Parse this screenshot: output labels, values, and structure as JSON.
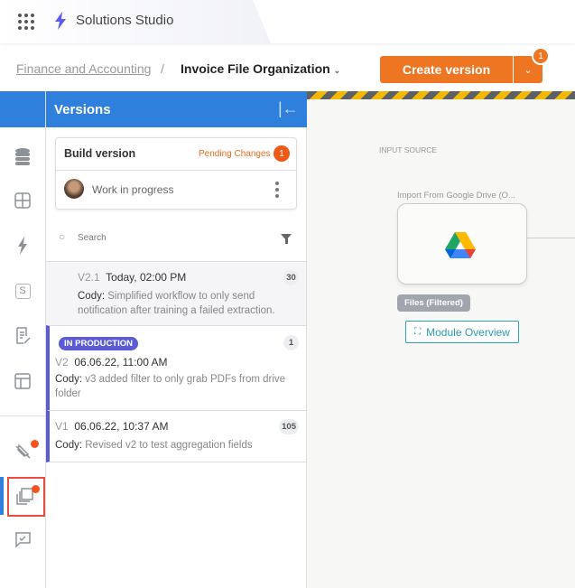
{
  "app": {
    "title": "Solutions Studio",
    "grid_icon": "apps-grid-icon",
    "logo_icon": "lightning-bolt-icon"
  },
  "breadcrumb": {
    "parent": "Finance and Accounting",
    "separator": "/",
    "current": "Invoice File Organization"
  },
  "actions": {
    "create_label": "Create version",
    "badge": "1",
    "accent": "#ee7623"
  },
  "rail": {
    "items": [
      "database-icon",
      "grid-icon",
      "lightning-icon",
      "s-box-icon",
      "document-edit-icon",
      "layout-icon",
      "plug-icon",
      "versions-icon",
      "message-check-icon"
    ],
    "active": "versions-icon"
  },
  "versions": {
    "title": "Versions",
    "build": {
      "title": "Build version",
      "pending_label": "Pending Changes",
      "pending_count": "1",
      "wip": "Work in progress"
    },
    "search_placeholder": "Search",
    "items": [
      {
        "num": "V2.1",
        "date": "Today, 02:00 PM",
        "author": "Cody:",
        "message": "Simplified workflow to only send notification after training a failed extraction.",
        "count": "30"
      },
      {
        "badge": "IN PRODUCTION",
        "num": "V2",
        "date": "06.06.22, 11:00 AM",
        "author": "Cody:",
        "message": "v3 added filter to only grab PDFs from drive folder",
        "count": "1"
      },
      {
        "num": "V1",
        "date": "06.06.22, 10:37 AM",
        "author": "Cody:",
        "message": "Revised v2 to test aggregation fields",
        "count": "105"
      }
    ]
  },
  "canvas": {
    "section": "INPUT SOURCE",
    "node_label": "Import From Google Drive (O...",
    "node_icon": "google-drive-icon",
    "output_pill": "Files (Filtered)",
    "module_overview": "Module Overview"
  }
}
